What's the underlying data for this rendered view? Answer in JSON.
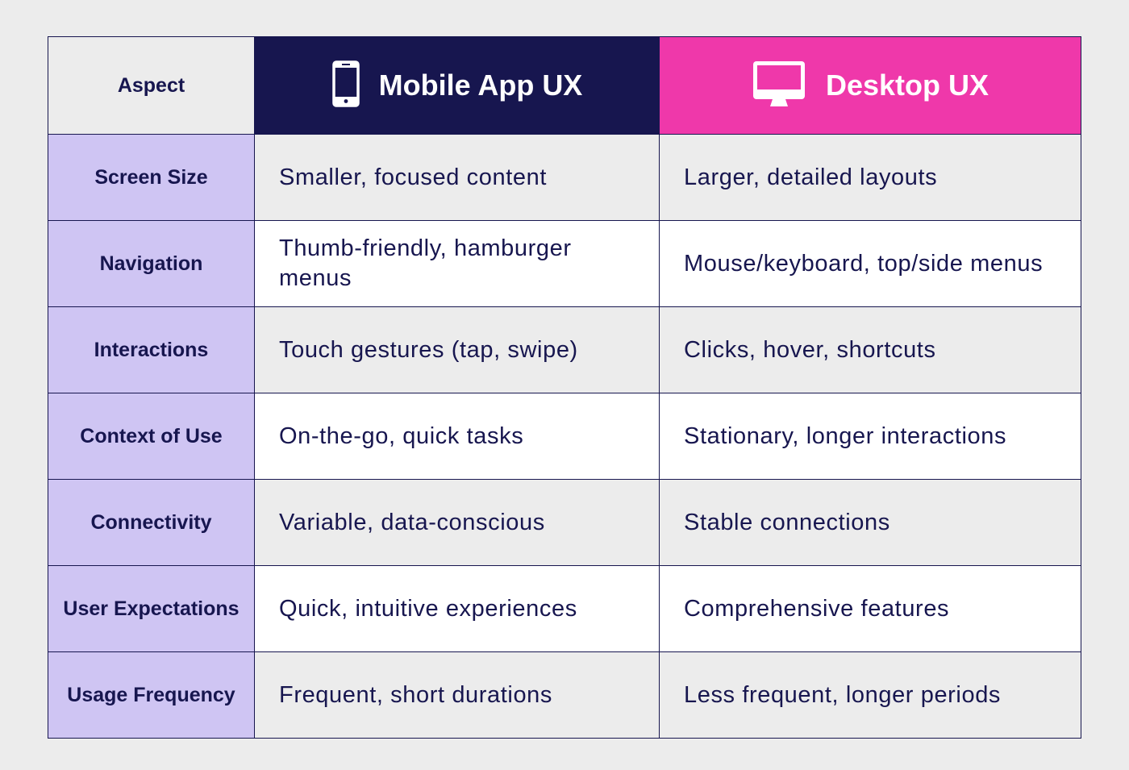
{
  "header": {
    "aspect_label": "Aspect",
    "mobile": {
      "label": "Mobile App UX",
      "icon": "smartphone-icon",
      "color": "#17164f"
    },
    "desktop": {
      "label": "Desktop UX",
      "icon": "monitor-icon",
      "color": "#ef38aa"
    }
  },
  "colors": {
    "aspect_column_bg": "#cfc5f3",
    "text": "#17164f",
    "row_alt_bg": "#ececec",
    "row_plain_bg": "#ffffff"
  },
  "rows": [
    {
      "aspect": "Screen Size",
      "mobile": "Smaller, focused content",
      "desktop": "Larger, detailed layouts"
    },
    {
      "aspect": "Navigation",
      "mobile": "Thumb-friendly, hamburger menus",
      "desktop": "Mouse/keyboard, top/side menus"
    },
    {
      "aspect": "Interactions",
      "mobile": "Touch gestures (tap, swipe)",
      "desktop": "Clicks, hover, shortcuts"
    },
    {
      "aspect": "Context of Use",
      "mobile": "On-the-go, quick tasks",
      "desktop": "Stationary, longer interactions"
    },
    {
      "aspect": "Connectivity",
      "mobile": "Variable, data-conscious",
      "desktop": "Stable connections"
    },
    {
      "aspect": "User Expectations",
      "mobile": "Quick, intuitive experiences",
      "desktop": "Comprehensive features"
    },
    {
      "aspect": "Usage Frequency",
      "mobile": "Frequent, short durations",
      "desktop": "Less frequent, longer periods"
    }
  ]
}
